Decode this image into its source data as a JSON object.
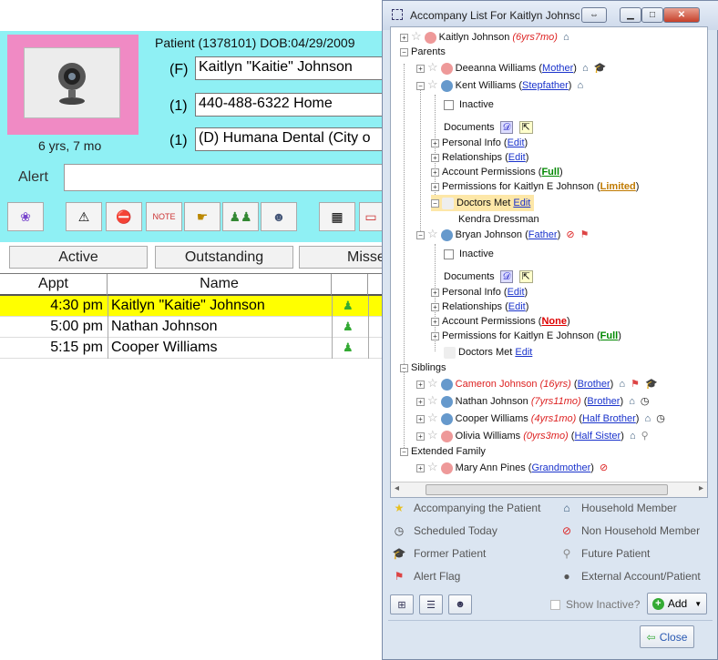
{
  "patient": {
    "header": "Patient (1378101)",
    "dob": "DOB:04/29/2009",
    "age": "6 yrs, 7 mo",
    "name_prefix": "(F)",
    "name": "Kaitlyn \"Kaitie\" Johnson",
    "phone_prefix": "(1)",
    "phone": "440-488-6322  Home",
    "ins_prefix": "(1)",
    "insurance": "(D) Humana Dental (City o",
    "alert_label": "Alert"
  },
  "tabs": [
    "Active",
    "Outstanding",
    "Misse"
  ],
  "grid": {
    "headers": [
      "Appt",
      "Name"
    ],
    "rows": [
      {
        "time": "4:30 pm",
        "name": "Kaitlyn \"Kaitie\" Johnson",
        "selected": true
      },
      {
        "time": "5:00 pm",
        "name": "Nathan Johnson",
        "selected": false
      },
      {
        "time": "5:15 pm",
        "name": "Cooper Williams",
        "selected": false
      }
    ]
  },
  "dialog": {
    "title": "Accompany List For Kaitlyn Johnson",
    "root": {
      "name": "Kaitlyn Johnson",
      "age": "(6yrs7mo)"
    },
    "parents_label": "Parents",
    "parent1": {
      "name": "Deeanna Williams",
      "rel": "Mother"
    },
    "parent2": {
      "name": "Kent Williams",
      "rel": "Stepfather"
    },
    "parent3": {
      "name": "Bryan Johnson",
      "rel": "Father"
    },
    "inactive": "Inactive",
    "documents": "Documents",
    "personal_info": "Personal Info",
    "relationships": "Relationships",
    "account_perm": "Account Permissions",
    "perm_for": "Permissions for Kaitlyn E Johnson",
    "doctors_met": "Doctors Met",
    "edit": "Edit",
    "full": "Full",
    "limited": "Limited",
    "none": "None",
    "kendra": "Kendra Dressman",
    "siblings_label": "Siblings",
    "sib1": {
      "name": "Cameron Johnson",
      "age": "(16yrs)",
      "rel": "Brother"
    },
    "sib2": {
      "name": "Nathan Johnson",
      "age": "(7yrs11mo)",
      "rel": "Brother"
    },
    "sib3": {
      "name": "Cooper Williams",
      "age": "(4yrs1mo)",
      "rel": "Half Brother"
    },
    "sib4": {
      "name": "Olivia Williams",
      "age": "(0yrs3mo)",
      "rel": "Half Sister"
    },
    "ext_label": "Extended Family",
    "ext1": {
      "name": "Mary Ann Pines",
      "rel": "Grandmother"
    },
    "legend": {
      "accompanying": "Accompanying the Patient",
      "household": "Household Member",
      "scheduled": "Scheduled Today",
      "non_household": "Non Household Member",
      "former": "Former Patient",
      "future": "Future Patient",
      "alert_flag": "Alert Flag",
      "external": "External Account/Patient"
    },
    "show_inactive": "Show Inactive?",
    "add": "Add",
    "close": "Close"
  },
  "colors": {
    "cyan": "#8ff0f4",
    "pink": "#f08ac4",
    "selected_row": "#ffff00"
  }
}
